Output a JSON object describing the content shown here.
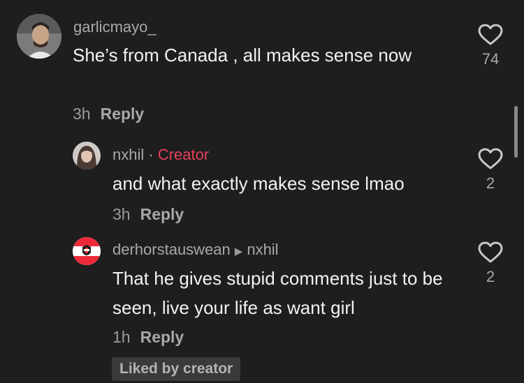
{
  "comments": [
    {
      "username": "garlicmayo_",
      "text": "She’s from Canada , all makes sense now",
      "time": "3h",
      "reply": "Reply",
      "likes": "74"
    },
    {
      "username": "nxhil",
      "separator": "·",
      "creator_tag": "Creator",
      "text": "and what exactly makes sense lmao",
      "time": "3h",
      "reply": "Reply",
      "likes": "2"
    },
    {
      "username": "derhorstauswean",
      "reply_to": "nxhil",
      "text": "That he gives stupid comments just to be seen, live your life as want girl",
      "time": "1h",
      "reply": "Reply",
      "likes": "2",
      "liked_by": "Liked by creator"
    }
  ],
  "colors": {
    "background": "#1e1e1e",
    "creator_accent": "#e8405b",
    "flag_red": "#ed2939"
  },
  "icons": [
    "heart-icon",
    "avatar-photo",
    "austria-flag-avatar",
    "play-arrow-icon"
  ]
}
